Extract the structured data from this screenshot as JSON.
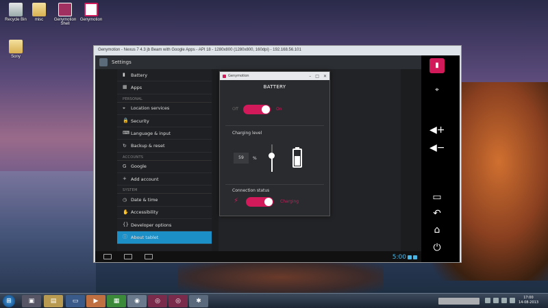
{
  "desktop": {
    "icons": [
      {
        "label": "Recycle Bin",
        "icon": "recycle-bin-icon"
      },
      {
        "label": "misc",
        "icon": "folder-icon"
      },
      {
        "label": "Genymotion Shell",
        "icon": "genymotion-shell-icon"
      },
      {
        "label": "Genymotion",
        "icon": "genymotion-icon"
      },
      {
        "label": "Sony",
        "icon": "folder-icon"
      }
    ]
  },
  "emulator": {
    "title": "Genymotion - Nexus 7 4.3 jb Beam with Google Apps - API 18 - 1280x800 (1280x800, 160dpi) - 192.168.56.101"
  },
  "android": {
    "actionbar_title": "Settings",
    "settings": [
      {
        "type": "item",
        "label": "Battery",
        "icon": "battery-icon"
      },
      {
        "type": "item",
        "label": "Apps",
        "icon": "apps-icon"
      },
      {
        "type": "header",
        "label": "PERSONAL"
      },
      {
        "type": "item",
        "label": "Location services",
        "icon": "location-icon"
      },
      {
        "type": "item",
        "label": "Security",
        "icon": "lock-icon"
      },
      {
        "type": "item",
        "label": "Language & input",
        "icon": "keyboard-icon"
      },
      {
        "type": "item",
        "label": "Backup & reset",
        "icon": "backup-icon"
      },
      {
        "type": "header",
        "label": "ACCOUNTS"
      },
      {
        "type": "item",
        "label": "Google",
        "icon": "google-icon"
      },
      {
        "type": "item",
        "label": "Add account",
        "icon": "plus-icon"
      },
      {
        "type": "header",
        "label": "SYSTEM"
      },
      {
        "type": "item",
        "label": "Date & time",
        "icon": "clock-icon"
      },
      {
        "type": "item",
        "label": "Accessibility",
        "icon": "accessibility-icon"
      },
      {
        "type": "item",
        "label": "Developer options",
        "icon": "code-icon"
      },
      {
        "type": "item",
        "label": "About tablet",
        "icon": "info-icon",
        "selected": true
      }
    ],
    "clock": "5:00"
  },
  "battery_widget": {
    "window_title": "Genymotion",
    "heading": "BATTERY",
    "off_label": "Off",
    "on_label": "On",
    "charging_level_label": "Charging level",
    "level_value": "59",
    "level_unit": "%",
    "level_fraction": 0.59,
    "connection_status_label": "Connection status",
    "connection_value": "Charging",
    "accent": "#d2195a"
  },
  "taskbar": {
    "time": "17:00",
    "date": "14-08-2013"
  }
}
